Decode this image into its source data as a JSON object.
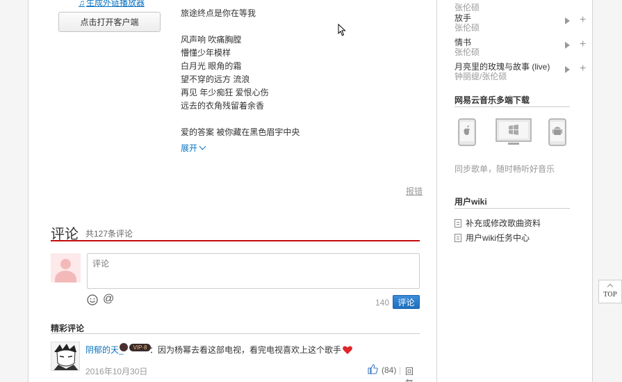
{
  "player": {
    "ext_link": "生成外链播放器",
    "open_client": "点击打开客户端"
  },
  "lyrics": {
    "lines": [
      "旅途终点是你在等我",
      "",
      "风声响 吹痛胸膛",
      "懵懂少年模样",
      "白月光 眼角的霜",
      "望不穿的远方 流浪",
      "再见 年少痴狂 爱恨心伤",
      "远去的衣角残留着余香",
      "",
      "爱的答案 被你藏在黑色眉宇中央"
    ],
    "expand": "展开",
    "report": "报错"
  },
  "comments": {
    "title": "评论",
    "count": "共127条评论",
    "placeholder": "评论",
    "char_left": "140",
    "submit": "评论",
    "hot_title": "精彩评论",
    "items": [
      {
        "user": "阴郁的天_",
        "vip": "VIP·8",
        "text": "：因为杨幂去看这部电视，看完电视喜欢上这个歌手",
        "date": "2016年10月30日",
        "likes": "(84)",
        "reply": "回复"
      }
    ]
  },
  "sidebar": {
    "songs": [
      {
        "title": "",
        "artist": "张伦硕"
      },
      {
        "title": "放手",
        "artist": "张伦硕"
      },
      {
        "title": "情书",
        "artist": "张伦硕"
      },
      {
        "title": "月亮里的玫瑰与故事 (live)",
        "artist": "钟丽缇/张伦硕"
      }
    ],
    "download_title": "网易云音乐多端下载",
    "download_slogan": "同步歌单，随时畅听好音乐",
    "wiki_title": "用户wiki",
    "wiki_links": [
      "补充或修改歌曲资料",
      "用户wiki任务中心"
    ]
  },
  "back_to_top": "TOP",
  "colors": {
    "accent": "#c20c0c",
    "link": "#0c73c2"
  }
}
